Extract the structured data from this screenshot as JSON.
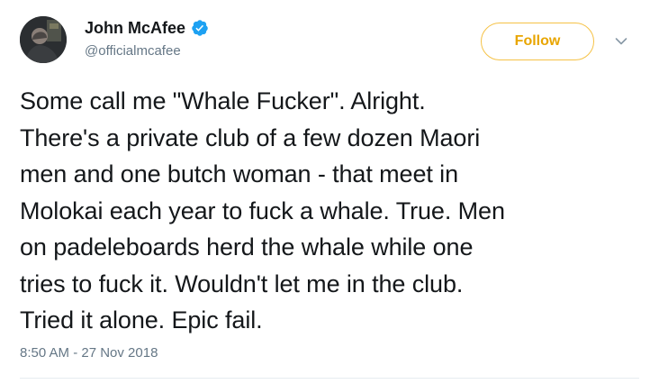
{
  "author": {
    "display_name": "John McAfee",
    "handle": "@officialmcafee",
    "verified": true,
    "verified_icon": "verified-badge-icon",
    "avatar_icon": "profile-avatar"
  },
  "actions": {
    "follow_label": "Follow",
    "more_icon": "chevron-down-icon"
  },
  "tweet": {
    "text": "Some call me \"Whale Fucker\". Alright.\nThere's a private club of a few dozen Maori\nmen and one butch woman - that meet in\nMolokai each year to fuck a whale. True. Men\non padeleboards herd the whale while one\ntries to fuck it. Wouldn't let me in the club.\nTried it alone. Epic fail.",
    "timestamp": "8:50 AM - 27 Nov 2018"
  },
  "colors": {
    "accent": "#1da1f2",
    "follow_border": "#f5c246",
    "follow_text": "#e8a500",
    "secondary_text": "#657786"
  }
}
